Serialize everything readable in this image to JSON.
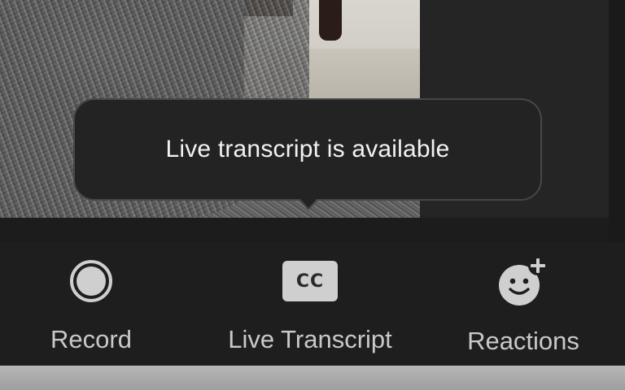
{
  "tooltip": {
    "text": "Live transcript is available"
  },
  "toolbar": {
    "items": [
      {
        "label": "Record",
        "icon": "record-icon"
      },
      {
        "label": "Live Transcript",
        "icon": "cc-icon",
        "icon_text": "CC"
      },
      {
        "label": "Reactions",
        "icon": "reaction-add-icon"
      }
    ]
  },
  "colors": {
    "toolbar_bg": "#1e1e1e",
    "tooltip_bg": "#232323",
    "tooltip_border": "#474747",
    "icon": "#cfcfcf",
    "label": "#c9c9c9"
  }
}
